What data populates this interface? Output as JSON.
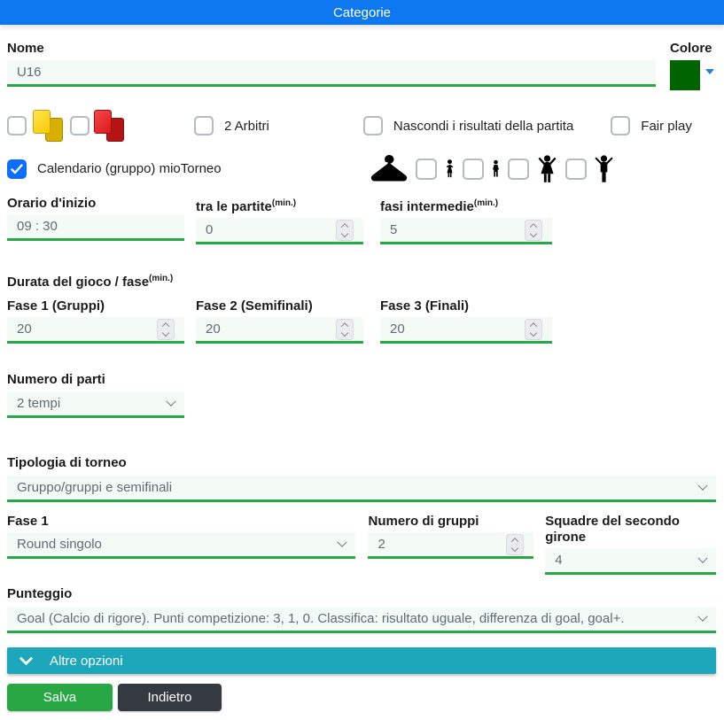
{
  "header": {
    "title": "Categorie"
  },
  "form": {
    "nome": {
      "label": "Nome",
      "value": "U16"
    },
    "colore": {
      "label": "Colore",
      "swatch_hex": "#006400"
    },
    "options_row": {
      "yellow_card": {
        "checked": false,
        "icon": "yellow-cards-icon"
      },
      "red_card": {
        "checked": false,
        "icon": "red-cards-icon"
      },
      "arbitri": {
        "label": "2 Arbitri",
        "checked": false
      },
      "nascondi": {
        "label": "Nascondi i risultati della partita",
        "checked": false
      },
      "fair_play": {
        "label": "Fair play",
        "checked": false
      }
    },
    "calendario": {
      "label": "Calendario (gruppo) mioTorneo",
      "checked": true
    },
    "divise": {
      "icons": [
        "hanger-icon",
        "girl-icon",
        "boy-icon",
        "woman-icon",
        "man-icon"
      ],
      "girl_checked": false,
      "boy_checked": false,
      "woman_checked": false,
      "man_checked": false
    },
    "orari": {
      "inizio": {
        "label": "Orario d'inizio",
        "value": "09 : 30"
      },
      "tra_le_partite": {
        "label": "tra le partite",
        "unit": "(min.)",
        "value": "0"
      },
      "fasi_intermedie": {
        "label": "fasi intermedie",
        "unit": "(min.)",
        "value": "5"
      }
    },
    "durata": {
      "heading": "Durata del gioco / fase",
      "unit": "(min.)",
      "fields": [
        {
          "label": "Fase 1 (Gruppi)",
          "value": "20"
        },
        {
          "label": "Fase 2 (Semifinali)",
          "value": "20"
        },
        {
          "label": "Fase 3 (Finali)",
          "value": "20"
        }
      ]
    },
    "numero_parti": {
      "label": "Numero di parti",
      "value": "2 tempi"
    },
    "tipologia": {
      "label": "Tipologia di torneo",
      "value": "Gruppo/gruppi e semifinali"
    },
    "fase_config": {
      "fase1": {
        "label": "Fase 1",
        "value": "Round singolo"
      },
      "numero_gruppi": {
        "label": "Numero di gruppi",
        "value": "2"
      },
      "squadre_secondo_girone": {
        "label": "Squadre del secondo girone",
        "value": "4"
      }
    },
    "punteggio": {
      "label": "Punteggio",
      "value": "Goal (Calcio di rigore). Punti competizione: 3, 1, 0. Classifica: risultato uguale, differenza di goal, goal+."
    }
  },
  "altre_opzioni": {
    "label": "Altre opzioni"
  },
  "actions": {
    "salva": "Salva",
    "indietro": "Indietro"
  },
  "colors": {
    "header_blue": "#0d78f0",
    "accent_green": "#28a745",
    "input_bg": "#f4faf6",
    "teal_bar": "#1da7ba",
    "checkbox_checked_blue": "#0d6efd",
    "salva_green": "#28a745",
    "indietro_dark": "#343a40",
    "colore_swatch": "#006400"
  }
}
